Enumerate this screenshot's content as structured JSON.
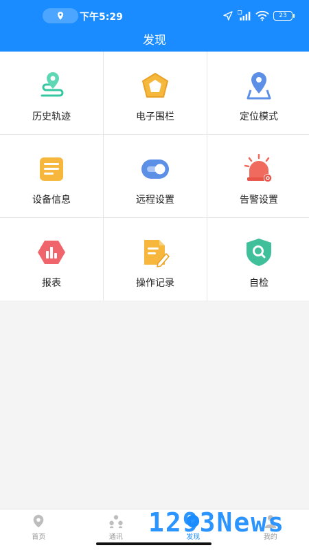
{
  "status_bar": {
    "time": "下午5:29",
    "battery": "23",
    "icons": [
      "location-icon",
      "navigation-arrow-icon",
      "hd-signal-icon",
      "wifi-icon",
      "battery-icon"
    ]
  },
  "header": {
    "title": "发现"
  },
  "grid": [
    {
      "label": "历史轨迹",
      "icon": "route-pin-icon"
    },
    {
      "label": "电子围栏",
      "icon": "pentagon-fence-icon"
    },
    {
      "label": "定位模式",
      "icon": "map-pin-icon"
    },
    {
      "label": "设备信息",
      "icon": "document-list-icon"
    },
    {
      "label": "远程设置",
      "icon": "toggle-switch-icon"
    },
    {
      "label": "告警设置",
      "icon": "alarm-siren-icon"
    },
    {
      "label": "报表",
      "icon": "bar-chart-hexagon-icon"
    },
    {
      "label": "操作记录",
      "icon": "note-pen-icon"
    },
    {
      "label": "自检",
      "icon": "shield-search-icon"
    }
  ],
  "bottom_nav": [
    {
      "label": "首页",
      "icon": "location-pin-icon"
    },
    {
      "label": "通讯",
      "icon": "contacts-icon"
    },
    {
      "label": "发现",
      "icon": "discover-icon",
      "active": true
    },
    {
      "label": "我的",
      "icon": "person-icon"
    }
  ],
  "watermark": "1293News",
  "colors": {
    "brand": "#1a8cff",
    "background": "#f4f4f4"
  }
}
